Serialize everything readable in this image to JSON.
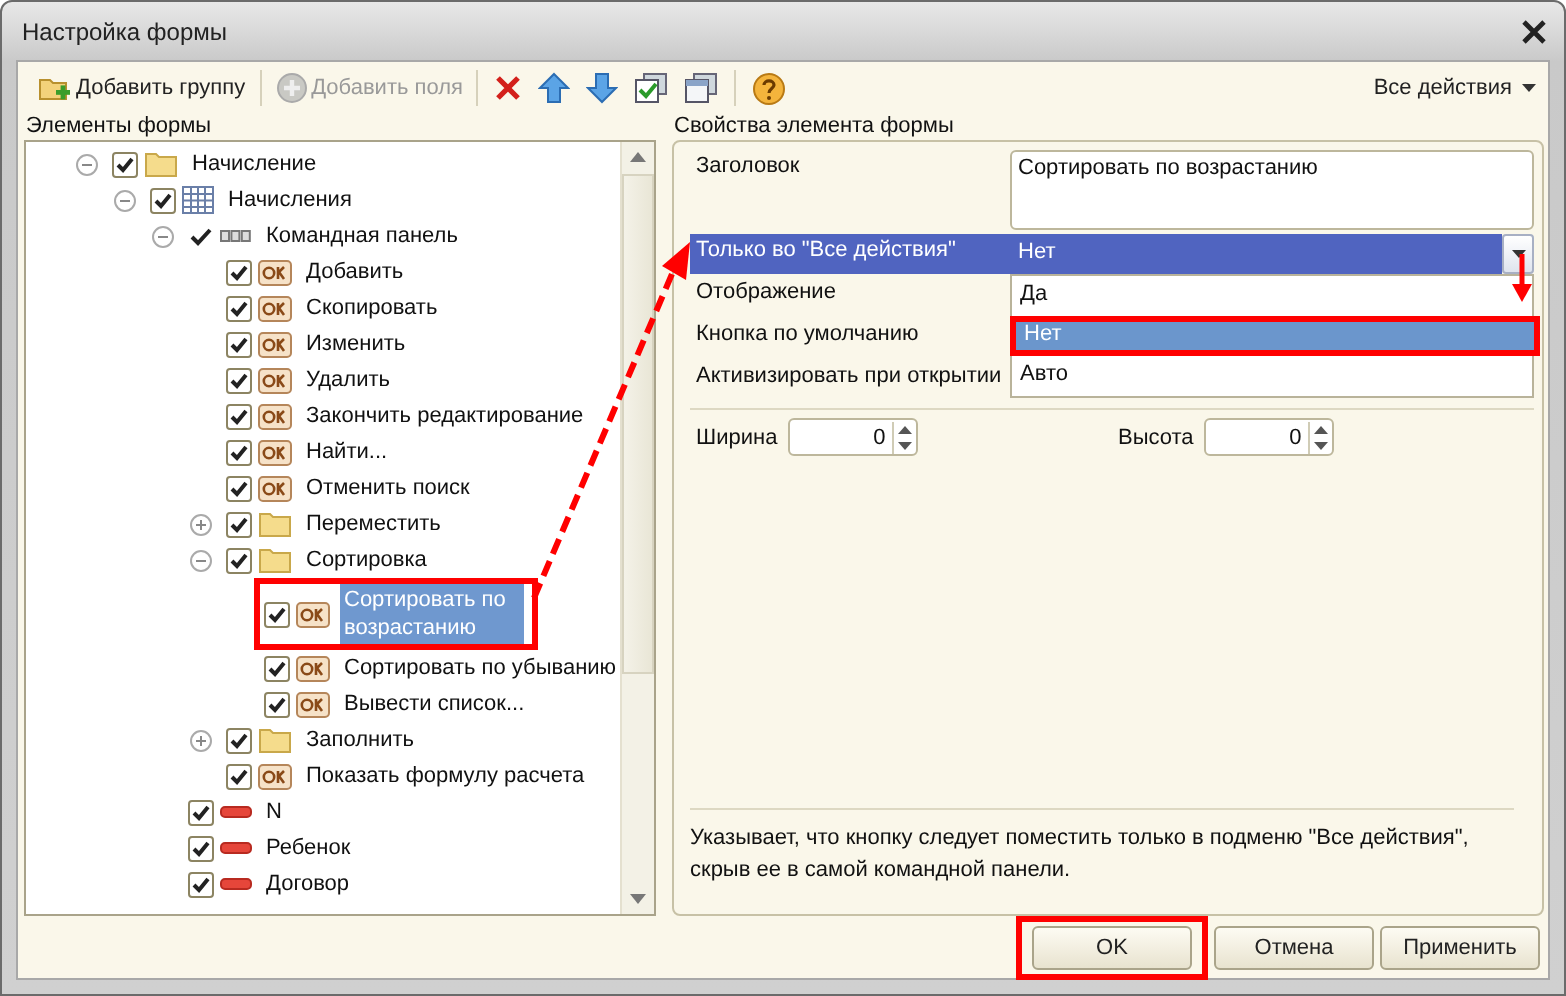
{
  "window": {
    "title": "Настройка формы"
  },
  "toolbar": {
    "buttons": [
      {
        "label": "Добавить группу",
        "disabled": false
      },
      {
        "label": "Добавить поля",
        "disabled": true
      }
    ],
    "all_actions": "Все действия"
  },
  "left_panel": {
    "title": "Элементы формы",
    "tree": [
      {
        "label": "Начисление",
        "kind": "folder",
        "checked": true,
        "expanded": true,
        "selected": false,
        "children": [
          {
            "label": "Начисления",
            "kind": "table",
            "checked": true,
            "expanded": true,
            "selected": false,
            "children": [
              {
                "label": "Командная панель",
                "kind": "panel",
                "checked": true,
                "expanded": true,
                "selected": false,
                "children": [
                  {
                    "label": "Добавить",
                    "kind": "command",
                    "checked": true,
                    "selected": false
                  },
                  {
                    "label": "Скопировать",
                    "kind": "command",
                    "checked": true,
                    "selected": false
                  },
                  {
                    "label": "Изменить",
                    "kind": "command",
                    "checked": true,
                    "selected": false
                  },
                  {
                    "label": "Удалить",
                    "kind": "command",
                    "checked": true,
                    "selected": false
                  },
                  {
                    "label": "Закончить редактирование",
                    "kind": "command",
                    "checked": true,
                    "selected": false
                  },
                  {
                    "label": "Найти...",
                    "kind": "command",
                    "checked": true,
                    "selected": false
                  },
                  {
                    "label": "Отменить поиск",
                    "kind": "command",
                    "checked": true,
                    "selected": false
                  },
                  {
                    "label": "Переместить",
                    "kind": "folder",
                    "checked": true,
                    "expanded": false,
                    "selected": false
                  },
                  {
                    "label": "Сортировка",
                    "kind": "folder",
                    "checked": true,
                    "expanded": true,
                    "selected": false,
                    "children": [
                      {
                        "label": "Сортировать по возрастанию",
                        "kind": "command",
                        "checked": true,
                        "selected": true
                      },
                      {
                        "label": "Сортировать по убыванию",
                        "kind": "command",
                        "checked": true,
                        "selected": false
                      },
                      {
                        "label": "Вывести список...",
                        "kind": "command",
                        "checked": true,
                        "selected": false
                      }
                    ]
                  },
                  {
                    "label": "Заполнить",
                    "kind": "folder",
                    "checked": true,
                    "expanded": false,
                    "selected": false
                  },
                  {
                    "label": "Показать формулу расчета",
                    "kind": "command",
                    "checked": true,
                    "selected": false
                  }
                ]
              },
              {
                "label": "N",
                "kind": "field",
                "checked": true,
                "selected": false
              },
              {
                "label": "Ребенок",
                "kind": "field",
                "checked": true,
                "selected": false
              },
              {
                "label": "Договор",
                "kind": "field",
                "checked": true,
                "selected": false
              }
            ]
          }
        ]
      }
    ]
  },
  "right_panel": {
    "title": "Свойства элемента формы",
    "properties": [
      {
        "label": "Заголовок",
        "kind": "text",
        "value": "Сортировать по возрастанию",
        "selected": false
      },
      {
        "label": "Только во \"Все действия\"",
        "kind": "select",
        "value": "Нет",
        "selected": true,
        "dropdown": [
          {
            "label": "Да",
            "selected": false
          },
          {
            "label": "Нет",
            "selected": true
          },
          {
            "label": "Авто",
            "selected": false
          }
        ]
      },
      {
        "label": "Отображение",
        "kind": "hidden",
        "selected": false
      },
      {
        "label": "Кнопка по умолчанию",
        "kind": "hidden",
        "selected": false
      },
      {
        "label": "Активизировать при открытии",
        "kind": "hidden",
        "selected": false
      }
    ],
    "sizes": [
      {
        "label": "Ширина",
        "value": "0"
      },
      {
        "label": "Высота",
        "value": "0"
      }
    ],
    "description": "Указывает, что кнопку следует поместить только в подменю \"Все действия\", скрыв ее в самой командной панели."
  },
  "buttons": [
    {
      "label": "OK",
      "highlighted": true
    },
    {
      "label": "Отмена",
      "highlighted": false
    },
    {
      "label": "Применить",
      "highlighted": false
    }
  ]
}
